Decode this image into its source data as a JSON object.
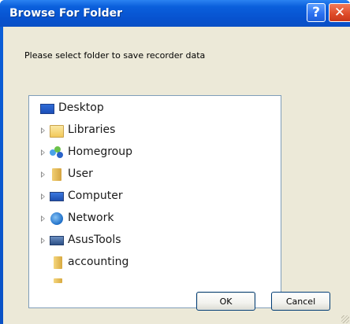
{
  "window": {
    "title": "Browse For Folder",
    "help_glyph": "?",
    "close_glyph": "✕"
  },
  "dialog": {
    "prompt": "Please select folder to save recorder data"
  },
  "tree": {
    "items": [
      {
        "label": "Desktop",
        "icon": "desktop-icon"
      },
      {
        "label": "Libraries",
        "icon": "libraries-icon"
      },
      {
        "label": "Homegroup",
        "icon": "homegroup-icon"
      },
      {
        "label": "User",
        "icon": "user-folder-icon"
      },
      {
        "label": "Computer",
        "icon": "computer-icon"
      },
      {
        "label": "Network",
        "icon": "network-icon"
      },
      {
        "label": "AsusTools",
        "icon": "asustools-icon"
      },
      {
        "label": "accounting",
        "icon": "folder-icon"
      }
    ]
  },
  "buttons": {
    "ok": "OK",
    "cancel": "Cancel"
  },
  "colors": {
    "titlebar": "#0752cf",
    "client_bg": "#ece9d8",
    "tree_border": "#7f9db9",
    "close_button": "#de4a28"
  }
}
